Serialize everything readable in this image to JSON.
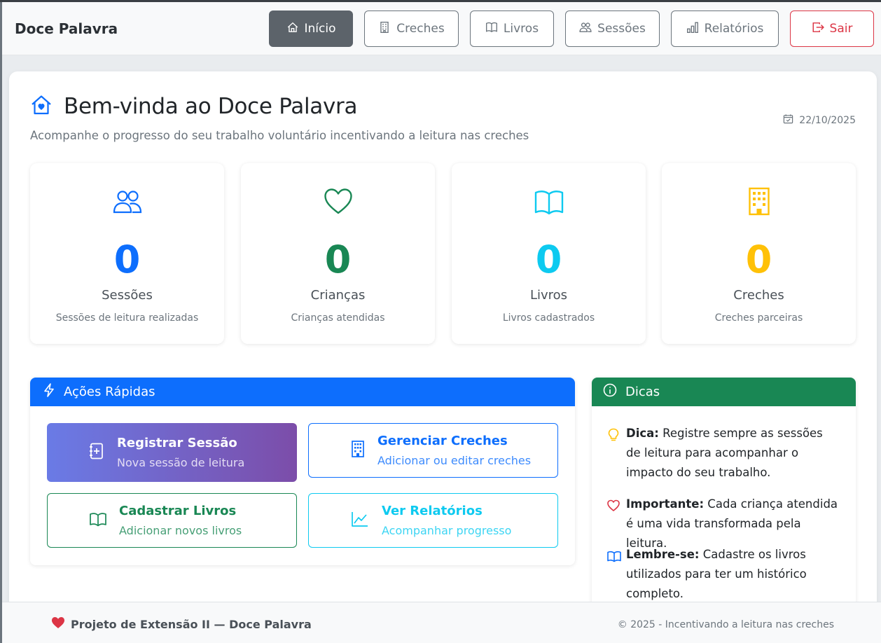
{
  "navbar": {
    "brand": "Doce Palavra",
    "items": [
      {
        "label": "Início",
        "icon": "home-icon"
      },
      {
        "label": "Creches",
        "icon": "building-icon"
      },
      {
        "label": "Livros",
        "icon": "book-icon"
      },
      {
        "label": "Sessões",
        "icon": "people-icon"
      },
      {
        "label": "Relatórios",
        "icon": "bar-chart-icon"
      }
    ],
    "logout": {
      "label": "Sair",
      "icon": "logout-icon"
    }
  },
  "header": {
    "title": "Bem-vinda ao Doce Palavra",
    "subtitle": "Acompanhe o progresso do seu trabalho voluntário incentivando a leitura nas creches",
    "date": "22/10/2025"
  },
  "stats": [
    {
      "value": "0",
      "label": "Sessões",
      "description": "Sessões de leitura realizadas",
      "color": "#0d6efd",
      "icon": "people-icon"
    },
    {
      "value": "0",
      "label": "Crianças",
      "description": "Crianças atendidas",
      "color": "#198754",
      "icon": "heart-icon"
    },
    {
      "value": "0",
      "label": "Livros",
      "description": "Livros cadastrados",
      "color": "#0dcaf0",
      "icon": "book-icon"
    },
    {
      "value": "0",
      "label": "Creches",
      "description": "Creches parceiras",
      "color": "#ffc107",
      "icon": "building-icon"
    }
  ],
  "quick_actions": {
    "title": "Ações Rápidas",
    "items": [
      {
        "title": "Registrar Sessão",
        "subtitle": "Nova sessão de leitura"
      },
      {
        "title": "Gerenciar Creches",
        "subtitle": "Adicionar ou editar creches"
      },
      {
        "title": "Cadastrar Livros",
        "subtitle": "Adicionar novos livros"
      },
      {
        "title": "Ver Relatórios",
        "subtitle": "Acompanhar progresso"
      }
    ]
  },
  "tips": {
    "title": "Dicas",
    "items": [
      {
        "bold": "Dica:",
        "text": " Registre sempre as sessões de leitura para acompanhar o impacto do seu trabalho."
      },
      {
        "bold": "Importante:",
        "text": " Cada criança atendida é uma vida transformada pela leitura."
      },
      {
        "bold": "Lembre-se:",
        "text": " Cadastre os livros utilizados para ter um histórico completo."
      }
    ]
  },
  "footer": {
    "left": "Projeto de Extensão II — Doce Palavra",
    "right": "© 2025 - Incentivando a leitura nas creches"
  },
  "colors": {
    "primary": "#0d6efd",
    "success": "#198754",
    "info": "#0dcaf0",
    "warning": "#ffc107",
    "danger": "#dc3545",
    "secondary": "#6c757d"
  }
}
